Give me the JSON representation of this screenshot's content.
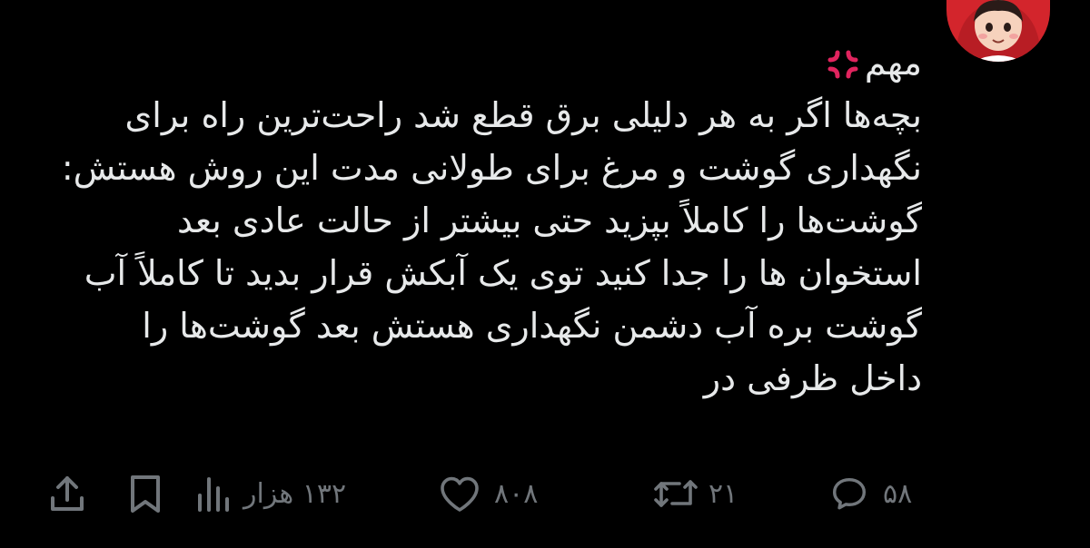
{
  "tweet": {
    "lines": [
      "مهم",
      "بچه‌ها اگر به هر دلیلی برق قطع شد راحت‌ترین راه برای",
      "نگهداری گوشت و مرغ برای طولانی مدت این روش هستش:",
      "گوشت‌ها را کاملاً بپزید حتی بیشتر از حالت عادی بعد",
      "استخوان ها را جدا کنید توی یک آبکش قرار بدید تا کاملاً آب",
      "گوشت بره آب دشمن نگهداری هستش بعد گوشت‌ها را",
      "داخل ظرفی در"
    ],
    "emoji": "anger-symbol-icon"
  },
  "actions": {
    "replies": "۵۸",
    "retweets": "۲۱",
    "likes": "۸۰۸",
    "views": "۱۳۲ هزار"
  },
  "icons": {
    "reply": "comment-bubble-icon",
    "retweet": "retweet-icon",
    "like": "heart-icon",
    "views": "views-bar-chart-icon",
    "bookmark": "bookmark-icon",
    "share": "share-upload-icon"
  },
  "colors": {
    "background": "#000000",
    "text": "#e7e9ea",
    "muted": "#71767b",
    "emoji_red": "#e0245e",
    "avatar_red": "#d3252c"
  }
}
